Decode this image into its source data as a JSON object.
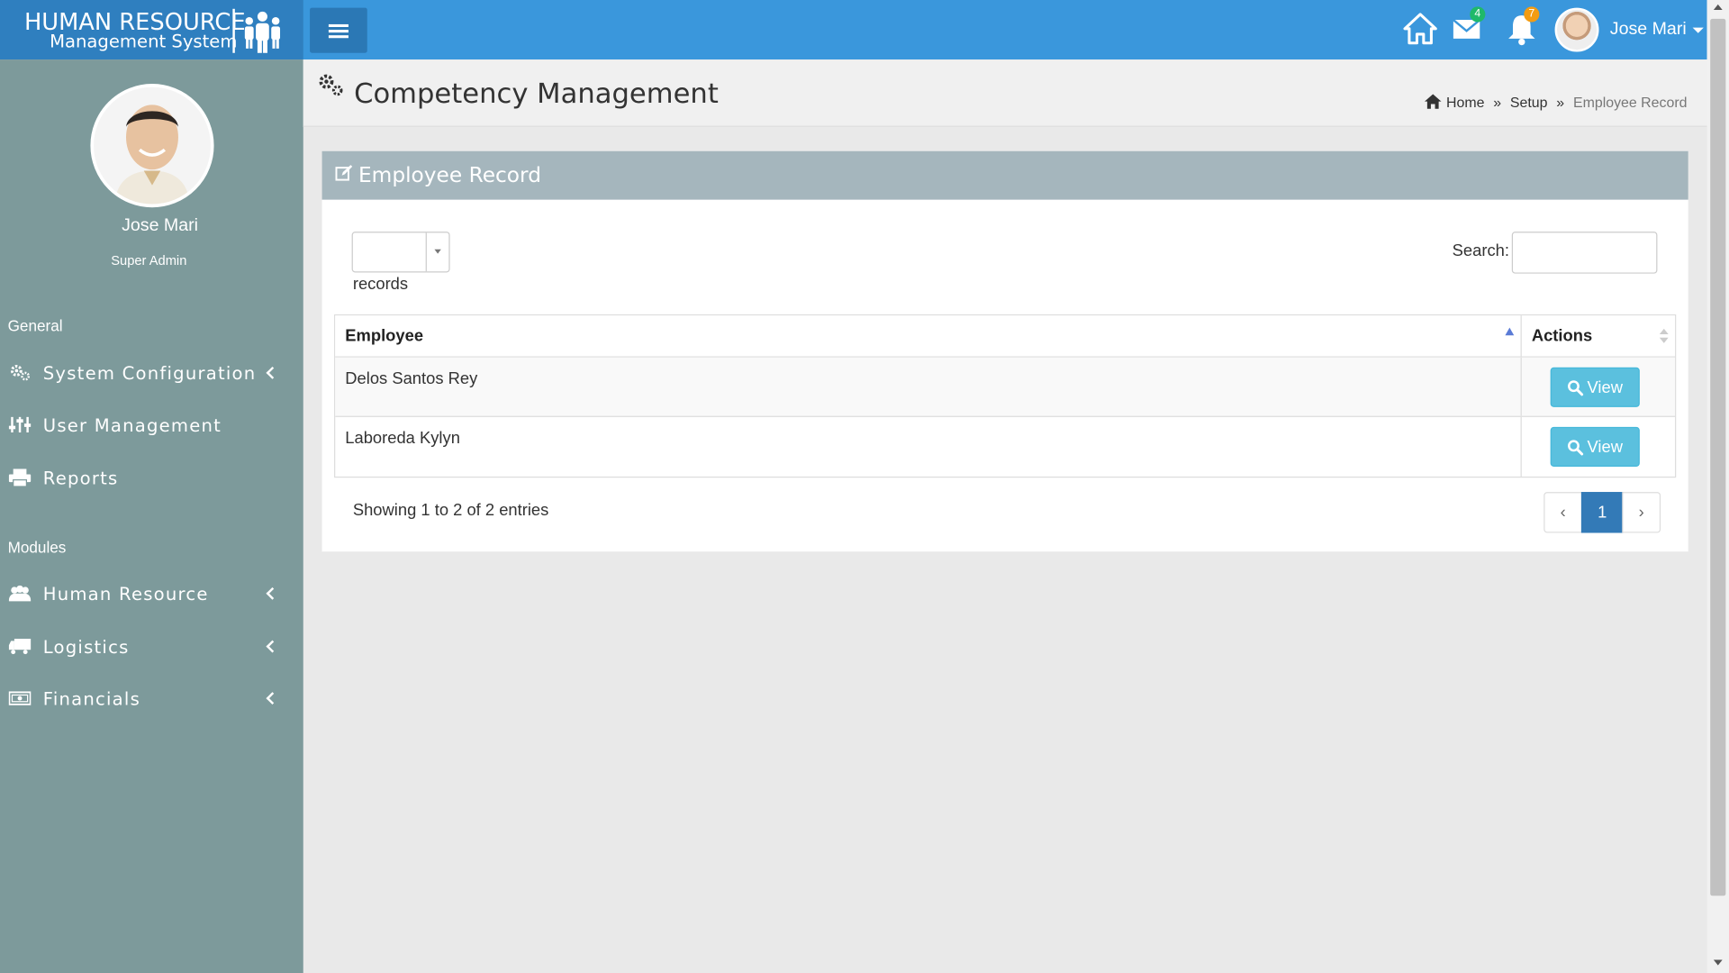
{
  "brand": {
    "line1": "HUMAN RESOURCE",
    "line2": "Management System"
  },
  "topbar": {
    "messages_count": "4",
    "notifications_count": "7",
    "user_name": "Jose Mari"
  },
  "sidebar": {
    "profile_name": "Jose Mari",
    "profile_role": "Super Admin",
    "section_general": "General",
    "section_modules": "Modules",
    "items": [
      {
        "label": "System Configuration",
        "icon": "gears-icon"
      },
      {
        "label": "User Management",
        "icon": "sliders-icon"
      },
      {
        "label": "Reports",
        "icon": "printer-icon"
      },
      {
        "label": "Human Resource",
        "icon": "users-icon"
      },
      {
        "label": "Logistics",
        "icon": "truck-icon"
      },
      {
        "label": "Financials",
        "icon": "money-icon"
      }
    ]
  },
  "page": {
    "title": "Competency Management",
    "breadcrumb": [
      "Home",
      "Setup",
      "Employee Record"
    ]
  },
  "panel": {
    "title": "Employee Record",
    "records_label": "records",
    "length_value": "",
    "search_label": "Search:",
    "search_value": "",
    "columns": [
      "Employee",
      "Actions"
    ],
    "rows": [
      {
        "employee": "Delos Santos Rey",
        "action": "View"
      },
      {
        "employee": "Laboreda Kylyn",
        "action": "View"
      }
    ],
    "info": "Showing 1 to 2 of 2 entries",
    "pagination": {
      "prev": "‹",
      "current": "1",
      "next": "›"
    }
  },
  "colors": {
    "topbar": "#3a97dc",
    "brand": "#2f7fbf",
    "sidebar": "#7d9a9b",
    "panel_header": "#a5b6bd",
    "view_button": "#5bc0de",
    "page_active": "#337ab7"
  }
}
